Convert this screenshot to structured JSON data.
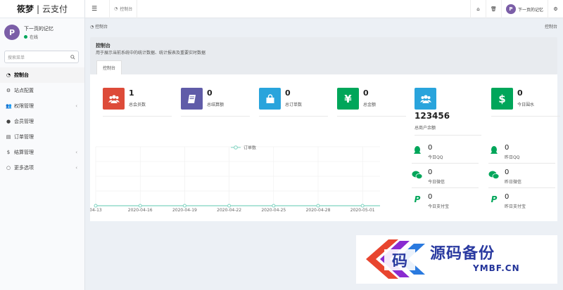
{
  "brand": {
    "name": "筱梦",
    "separator": "|",
    "product": "云支付"
  },
  "user": {
    "name": "下一页的记忆",
    "status": "在线",
    "avatar_letter": "P"
  },
  "search": {
    "placeholder": "搜索菜单"
  },
  "sidebar": {
    "items": [
      {
        "label": "控制台",
        "icon": "dashboard-icon",
        "active": true,
        "has_sub": false
      },
      {
        "label": "站点配置",
        "icon": "gear-icon",
        "active": false,
        "has_sub": false
      },
      {
        "label": "权限管理",
        "icon": "users-icon",
        "active": false,
        "has_sub": true
      },
      {
        "label": "会员管理",
        "icon": "user-icon",
        "active": false,
        "has_sub": false
      },
      {
        "label": "订单管理",
        "icon": "list-icon",
        "active": false,
        "has_sub": false
      },
      {
        "label": "结算管理",
        "icon": "dollar-icon",
        "active": false,
        "has_sub": true
      },
      {
        "label": "更多选项",
        "icon": "circle-icon",
        "active": false,
        "has_sub": true
      }
    ]
  },
  "topbar": {
    "tab_label": "控制台",
    "user_name": "下一页的记忆"
  },
  "breadcrumb": {
    "current": "控制台",
    "right": "控制台"
  },
  "panel": {
    "title": "控制台",
    "description": "用于展示当前系统中的统计数据、统计报表及重要实时数据",
    "tab": "控制台"
  },
  "stats": [
    {
      "value": "1",
      "label": "总会员数",
      "color": "#dd4b39",
      "icon": "users-icon"
    },
    {
      "value": "0",
      "label": "总结算额",
      "color": "#605ca8",
      "icon": "book-icon"
    },
    {
      "value": "0",
      "label": "总订单数",
      "color": "#29a4dc",
      "icon": "shopping-bag-icon"
    },
    {
      "value": "0",
      "label": "总金额",
      "color": "#00a65a",
      "icon": "yen-icon"
    }
  ],
  "big_stat": {
    "value": "123456",
    "label": "总商户余额",
    "color": "#29a4dc",
    "icon": "users-icon"
  },
  "right_stat": {
    "value": "0",
    "label": "今日围水",
    "color": "#00a65a",
    "icon": "dollar-icon"
  },
  "mini_stats": [
    {
      "value": "0",
      "label": "今日QQ",
      "icon": "qq-icon"
    },
    {
      "value": "0",
      "label": "昨日QQ",
      "icon": "qq-icon"
    },
    {
      "value": "0",
      "label": "今日微信",
      "icon": "wechat-icon"
    },
    {
      "value": "0",
      "label": "昨日微信",
      "icon": "wechat-icon"
    },
    {
      "value": "0",
      "label": "今日支付宝",
      "icon": "paypal-icon"
    },
    {
      "value": "0",
      "label": "昨日支付宝",
      "icon": "paypal-icon"
    }
  ],
  "chart_data": {
    "type": "line",
    "legend": "订单数",
    "x": [
      "04-13",
      "2020-04-16",
      "2020-04-19",
      "2020-04-22",
      "2020-04-25",
      "2020-04-28",
      "2020-05-01"
    ],
    "series": [
      {
        "name": "订单数",
        "values": [
          0,
          0,
          0,
          0,
          0,
          0,
          0
        ]
      }
    ],
    "grid": true,
    "color": "#7ed3c0"
  },
  "watermark": {
    "text": "源码备份",
    "sub": "YMBF.CN",
    "mark": "码"
  }
}
